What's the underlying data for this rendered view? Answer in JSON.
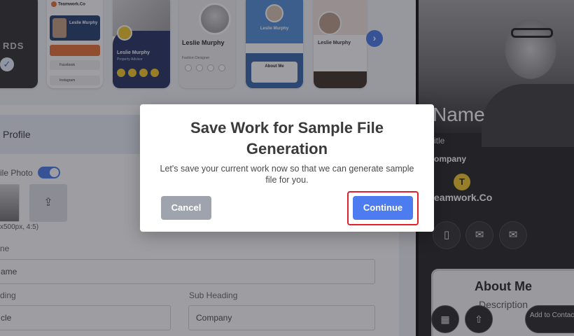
{
  "templates": {
    "tpl1_bg_text": "RDS",
    "tpl1_check": "✓",
    "tpl2_brand": "Teamwork.Co",
    "tpl2_name": "Leslie Murphy",
    "tpl2_row1": "Facebook",
    "tpl2_row2": "Instagram",
    "tpl3_name": "Leslie Murphy",
    "tpl3_sub": "Property Advisor",
    "tpl4_name": "Leslie Murphy",
    "tpl4_sub": "Fashion Designer",
    "tpl5_name": "Leslie Murphy",
    "tpl5_about": "About Me",
    "tpl6_name": "Leslie Murphy",
    "next_arrow": "›"
  },
  "form": {
    "section_title": "Profile",
    "profile_photo_label": "ile Photo",
    "upload_icon": "⇪",
    "size_hint": "x500px, 4:5)",
    "name_label": "ne",
    "name_value": "ame",
    "heading_label": "ding",
    "heading_value": "cle",
    "subheading_label": "Sub Heading",
    "subheading_value": "Company"
  },
  "preview": {
    "name": "Name",
    "title": "itle",
    "company": "ompany",
    "logo_letter": "T",
    "brand": "eamwork.Co",
    "about_heading": "About Me",
    "about_desc": "Description",
    "add_to_contact": "Add to Contact",
    "icons": [
      "phone-icon",
      "mail-icon",
      "message-icon",
      "qr-code-icon",
      "share-icon"
    ]
  },
  "dialog": {
    "title": "Save Work for Sample File Generation",
    "message": "Let's save your current work now so that we can generate sample file for you.",
    "cancel_label": "Cancel",
    "continue_label": "Continue"
  },
  "colors": {
    "accent": "#4d7cf0",
    "cancel": "#9ea3ad",
    "highlight": "#e0202a",
    "logo_yellow": "#f3c623"
  }
}
